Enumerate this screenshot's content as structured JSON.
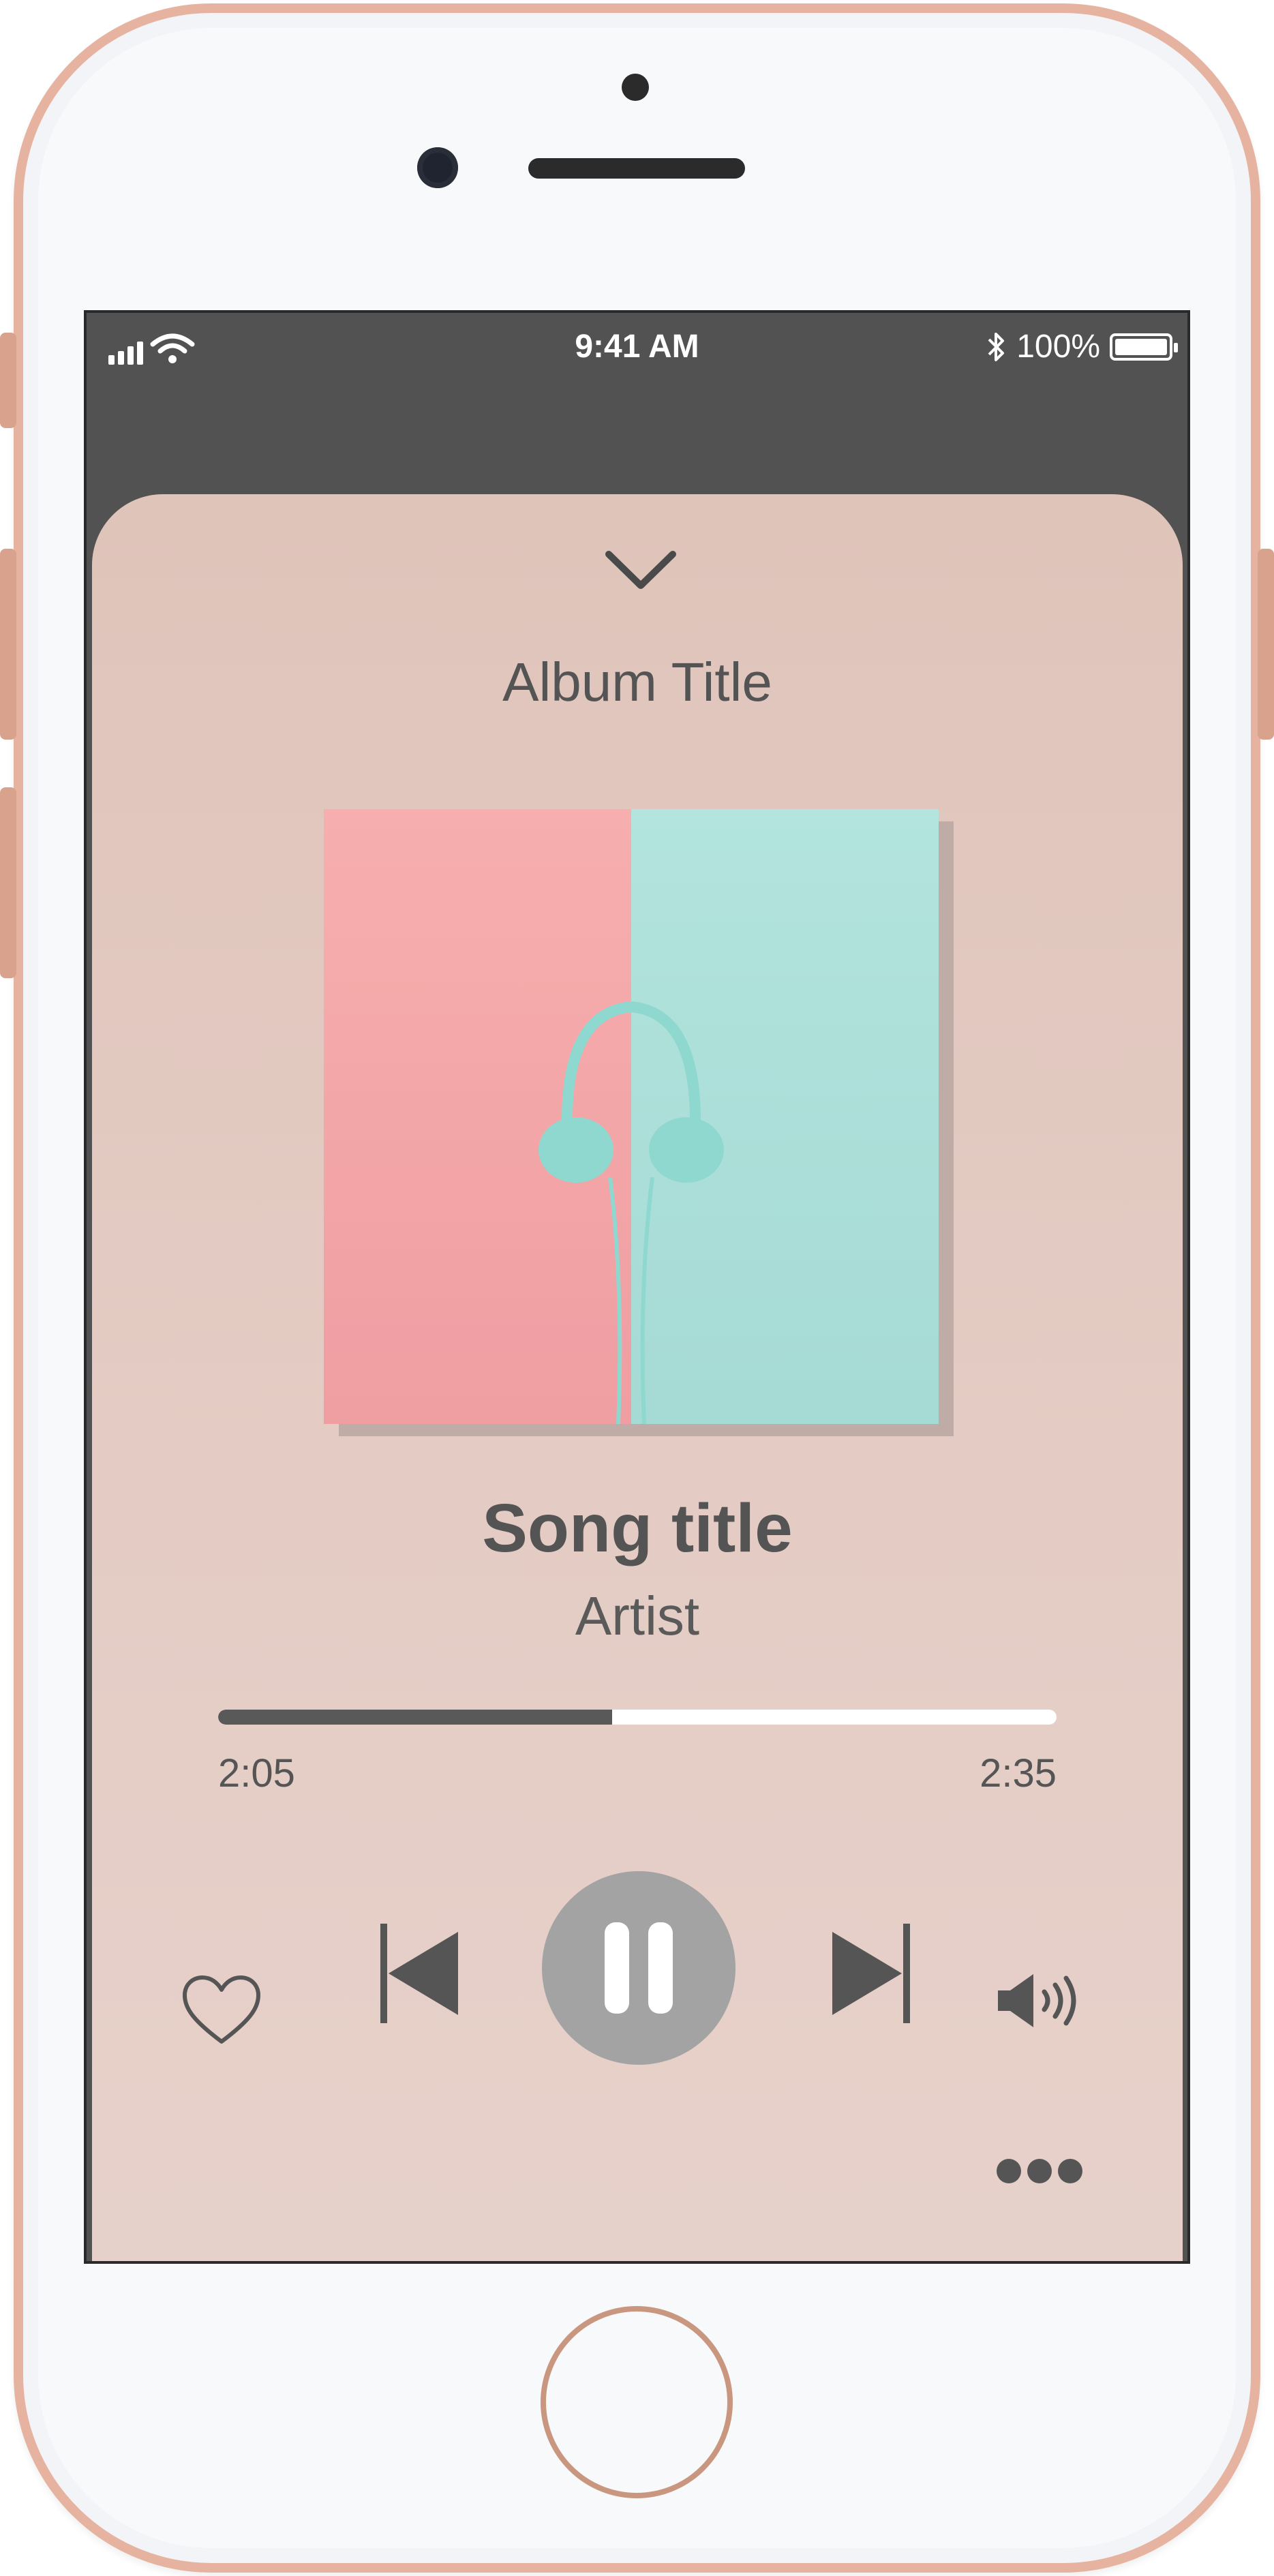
{
  "status_bar": {
    "time": "9:41 AM",
    "battery": "100%",
    "icons": [
      "signal-icon",
      "wifi-icon",
      "bluetooth-icon",
      "battery-icon"
    ]
  },
  "player": {
    "album_title": "Album Title",
    "song_title": "Song title",
    "artist": "Artist",
    "elapsed": "2:05",
    "total": "2:35",
    "progress_fraction": 0.47,
    "is_playing": true
  },
  "controls": {
    "icons": [
      "chevron-down-icon",
      "heart-icon",
      "previous-icon",
      "pause-icon",
      "next-icon",
      "volume-icon",
      "more-icon"
    ]
  },
  "colors": {
    "sheet_background": "#e2c9c0",
    "screen_background": "#525252",
    "text": "#545454",
    "progress_played": "#595959",
    "progress_remaining": "#ffffff",
    "play_button": "#a3a3a3",
    "art_left": "#f5a9aa",
    "art_right": "#aee0d9",
    "headphones": "#8fd8d0",
    "phone_frame": "#e6b3a0"
  }
}
